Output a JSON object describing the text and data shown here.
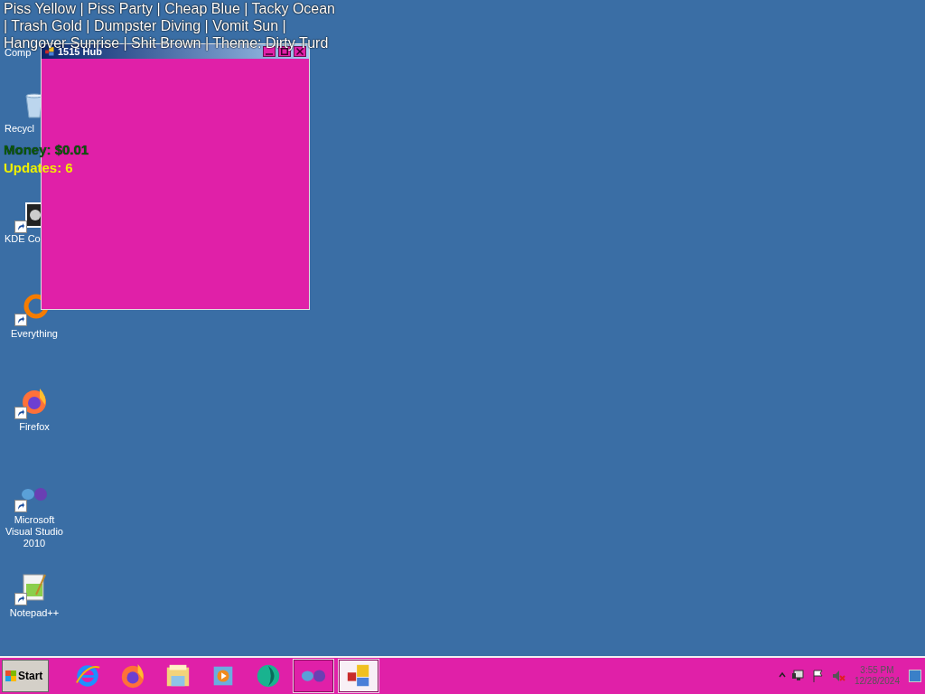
{
  "overlay_text": {
    "lines": [
      "Piss Yellow | Piss Party | Cheap Blue | Tacky Ocean",
      "| Trash Gold | Dumpster Diving | Vomit Sun |",
      "Hangover Sunrise | Shit Brown | Theme: Dirty Turd"
    ]
  },
  "stats": {
    "money": "Money: $0.01",
    "updates": "Updates: 6"
  },
  "desktop_icons": [
    {
      "kind": "computer",
      "label": "Comp",
      "partly_hidden": true
    },
    {
      "kind": "recycle",
      "label": "Recycl",
      "partly_hidden": true
    },
    {
      "kind": "kde",
      "label": "KDE Co",
      "partly_hidden": true
    },
    {
      "kind": "everything",
      "label": "Everything",
      "partly_hidden": false
    },
    {
      "kind": "firefox",
      "label": "Firefox",
      "partly_hidden": false
    },
    {
      "kind": "vs",
      "label": "Microsoft Visual Studio 2010",
      "partly_hidden": false
    },
    {
      "kind": "notepad",
      "label": "Notepad++",
      "partly_hidden": false
    }
  ],
  "window": {
    "title": "1515 Hub"
  },
  "taskbar": {
    "start": "Start",
    "buttons": [
      {
        "kind": "ie",
        "open": false,
        "selected": false
      },
      {
        "kind": "firefox",
        "open": false,
        "selected": false
      },
      {
        "kind": "explorer",
        "open": false,
        "selected": false
      },
      {
        "kind": "media",
        "open": false,
        "selected": false
      },
      {
        "kind": "green",
        "open": false,
        "selected": false
      },
      {
        "kind": "vs",
        "open": true,
        "selected": false
      },
      {
        "kind": "app",
        "open": true,
        "selected": true
      }
    ],
    "time": "3:55 PM",
    "date": "12/28/2024"
  }
}
